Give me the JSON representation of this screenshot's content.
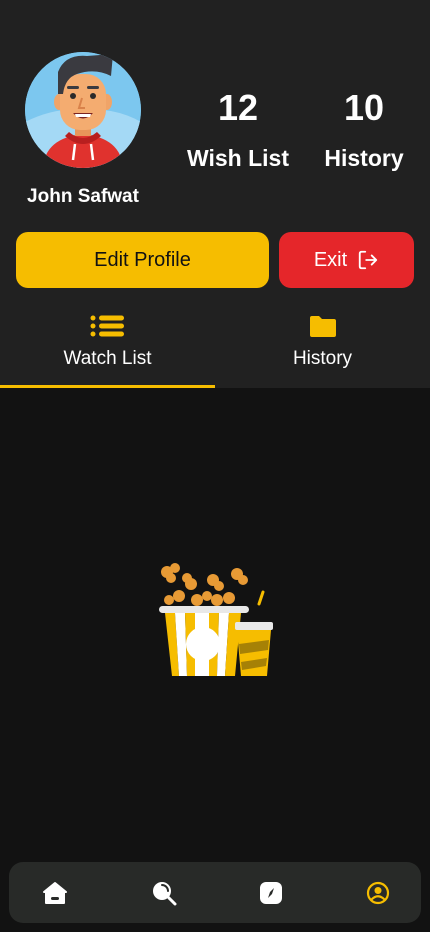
{
  "profile": {
    "name": "John Safwat",
    "avatar_icon": "cartoon-man-avatar"
  },
  "stats": {
    "wish_list": {
      "value": "12",
      "label": "Wish List"
    },
    "history": {
      "value": "10",
      "label": "History"
    }
  },
  "actions": {
    "edit_profile_label": "Edit Profile",
    "exit_label": "Exit",
    "exit_icon": "logout-icon"
  },
  "tabs": [
    {
      "label": "Watch List",
      "icon": "list-icon",
      "active": true
    },
    {
      "label": "History",
      "icon": "folder-icon",
      "active": false
    }
  ],
  "empty_state": {
    "icon": "popcorn-drink-icon"
  },
  "bottom_nav": [
    {
      "name": "home",
      "icon": "home-icon",
      "active": false
    },
    {
      "name": "search",
      "icon": "search-icon",
      "active": false
    },
    {
      "name": "browse",
      "icon": "compass-icon",
      "active": false
    },
    {
      "name": "profile",
      "icon": "profile-icon",
      "active": true
    }
  ],
  "colors": {
    "accent": "#f6bd00",
    "danger": "#e5262a",
    "background": "#121212",
    "header_background": "#212121",
    "nav_background": "#282a28"
  }
}
